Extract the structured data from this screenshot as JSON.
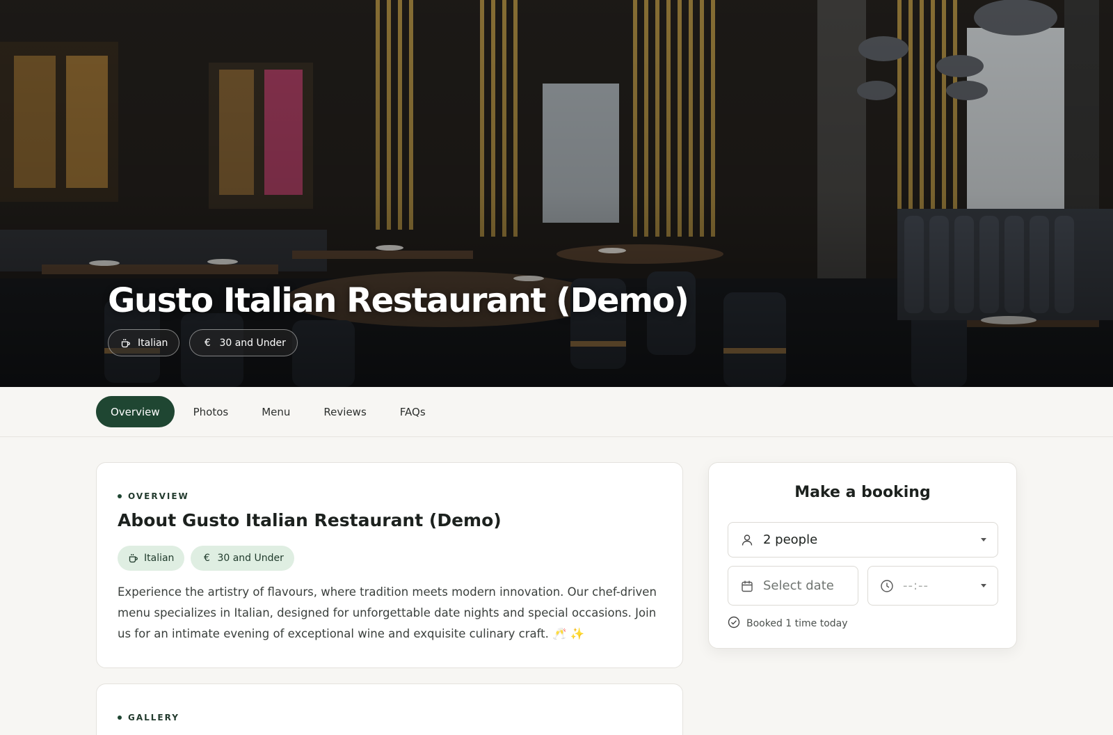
{
  "hero": {
    "title": "Gusto Italian Restaurant (Demo)",
    "chips": [
      {
        "icon": "coffee-cup-icon",
        "label": "Italian"
      },
      {
        "icon": "euro-icon",
        "label": "30 and Under"
      }
    ]
  },
  "tabs": [
    {
      "label": "Overview",
      "active": true
    },
    {
      "label": "Photos",
      "active": false
    },
    {
      "label": "Menu",
      "active": false
    },
    {
      "label": "Reviews",
      "active": false
    },
    {
      "label": "FAQs",
      "active": false
    }
  ],
  "overview": {
    "section_label": "OVERVIEW",
    "heading": "About Gusto Italian Restaurant (Demo)",
    "chips": [
      {
        "icon": "coffee-cup-icon",
        "label": "Italian"
      },
      {
        "icon": "euro-icon",
        "label": "30 and Under"
      }
    ],
    "description": "Experience the artistry of flavours, where tradition meets modern innovation. Our chef-driven menu specializes in Italian, designed for unforgettable date nights and special occasions. Join us for an intimate evening of exceptional wine and exquisite culinary craft. 🥂 ✨"
  },
  "gallery": {
    "section_label": "GALLERY"
  },
  "booking": {
    "title": "Make a booking",
    "party_size": "2 people",
    "date_placeholder": "Select date",
    "time_placeholder": "--:--",
    "booked_text": "Booked 1 time today"
  },
  "colors": {
    "accent": "#1f4632",
    "chip_bg": "#dfeee2",
    "page_bg": "#f7f6f3"
  }
}
